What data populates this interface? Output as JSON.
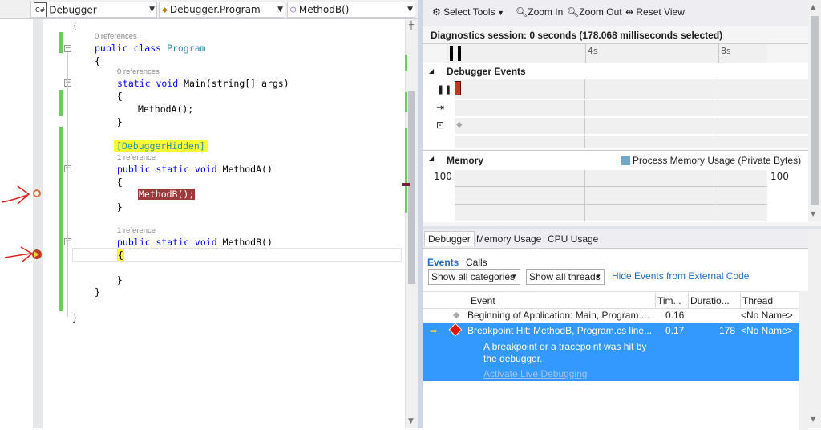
{
  "navbar": {
    "project": "Debugger",
    "class_dd": "Debugger.Program",
    "method_dd": "MethodB()",
    "project_icon": "C#"
  },
  "code": {
    "line_open_ns": "{",
    "ref0": "0 references",
    "line_class": "Program",
    "line_class_kw": "public class ",
    "line_brace1": "{",
    "ref1": "0 references",
    "line_main_kw": "static void ",
    "line_main_rest": "Main(string[] args)",
    "line_brace2": "{",
    "line_call_a": "MethodA();",
    "line_close2": "}",
    "attr": "[DebuggerHidden]",
    "ref2": "1 reference",
    "line_ma_kw": "public static void ",
    "line_ma_name": "MethodA()",
    "line_brace3": "{",
    "line_call_b": "MethodB();",
    "line_close3": "}",
    "ref3": "1 reference",
    "line_mb_kw": "public static void ",
    "line_mb_name": "MethodB()",
    "line_brace4": "{",
    "line_close4": "}",
    "line_close_class": "}",
    "line_close_ns": "}"
  },
  "diagnostics": {
    "select_tools": "Select Tools",
    "zoom_in": "Zoom In",
    "zoom_out": "Zoom Out",
    "reset_view": "Reset View",
    "session": "Diagnostics session: 0 seconds (178.068 milliseconds selected)",
    "tick_4s": "4s",
    "tick_8s": "8s",
    "debugger_events": "Debugger Events",
    "memory": "Memory",
    "memory_legend": "Process Memory Usage (Private Bytes)",
    "mem_left": "100",
    "mem_right": "100"
  },
  "bottom": {
    "tabs": [
      "Debugger",
      "Memory Usage",
      "CPU Usage"
    ],
    "subtabs": [
      "Events",
      "Calls"
    ],
    "categories": "Show all categories",
    "threads": "Show all threads",
    "hide_external": "Hide Events from External Code",
    "columns": [
      "Event",
      "Tim...",
      "Duratio...",
      "Thread"
    ],
    "rows": [
      {
        "event": "Beginning of Application: Main, Program....",
        "time": "0.16",
        "duration": "",
        "thread": "<No Name>"
      },
      {
        "event": "Breakpoint Hit: MethodB, Program.cs line...",
        "time": "0.17",
        "duration": "178",
        "thread": "<No Name>"
      }
    ],
    "detail": "A breakpoint or a tracepoint was hit by",
    "detail2": "the debugger.",
    "activate": "Activate Live Debugging"
  },
  "colors": {
    "selection": "#3399ff",
    "accent": "#1e6fbf",
    "breakpoint": "#e51400"
  }
}
